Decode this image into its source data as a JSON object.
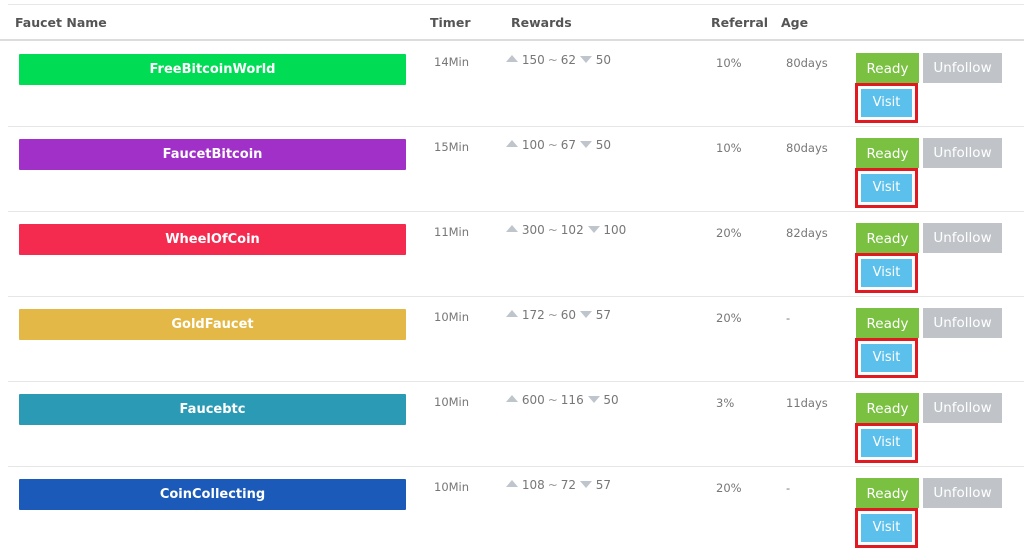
{
  "headers": {
    "name": "Faucet Name",
    "timer": "Timer",
    "rewards": "Rewards",
    "referral": "Referral",
    "age": "Age"
  },
  "tilde": "~",
  "colors": {
    "ready": "#7ac142",
    "unfollow": "#c0c4c8",
    "visit": "#5bc0eb",
    "highlight": "#e11a22"
  },
  "rows": [
    {
      "name": "FreeBitcoinWorld",
      "color": "#00dd55",
      "timer": "14Min",
      "reward_high": "150",
      "reward_avg": "62",
      "reward_low": "50",
      "referral": "10%",
      "age": "80days",
      "ready": "Ready",
      "unfollow": "Unfollow",
      "visit": "Visit"
    },
    {
      "name": "FaucetBitcoin",
      "color": "#a030c8",
      "timer": "15Min",
      "reward_high": "100",
      "reward_avg": "67",
      "reward_low": "50",
      "referral": "10%",
      "age": "80days",
      "ready": "Ready",
      "unfollow": "Unfollow",
      "visit": "Visit"
    },
    {
      "name": "WheelOfCoin",
      "color": "#f52a4f",
      "timer": "11Min",
      "reward_high": "300",
      "reward_avg": "102",
      "reward_low": "100",
      "referral": "20%",
      "age": "82days",
      "ready": "Ready",
      "unfollow": "Unfollow",
      "visit": "Visit"
    },
    {
      "name": "GoldFaucet",
      "color": "#e4b847",
      "timer": "10Min",
      "reward_high": "172",
      "reward_avg": "60",
      "reward_low": "57",
      "referral": "20%",
      "age": "-",
      "ready": "Ready",
      "unfollow": "Unfollow",
      "visit": "Visit"
    },
    {
      "name": "Faucebtc",
      "color": "#2b9ab5",
      "timer": "10Min",
      "reward_high": "600",
      "reward_avg": "116",
      "reward_low": "50",
      "referral": "3%",
      "age": "11days",
      "ready": "Ready",
      "unfollow": "Unfollow",
      "visit": "Visit"
    },
    {
      "name": "CoinCollecting",
      "color": "#1b5ab8",
      "timer": "10Min",
      "reward_high": "108",
      "reward_avg": "72",
      "reward_low": "57",
      "referral": "20%",
      "age": "-",
      "ready": "Ready",
      "unfollow": "Unfollow",
      "visit": "Visit"
    }
  ]
}
